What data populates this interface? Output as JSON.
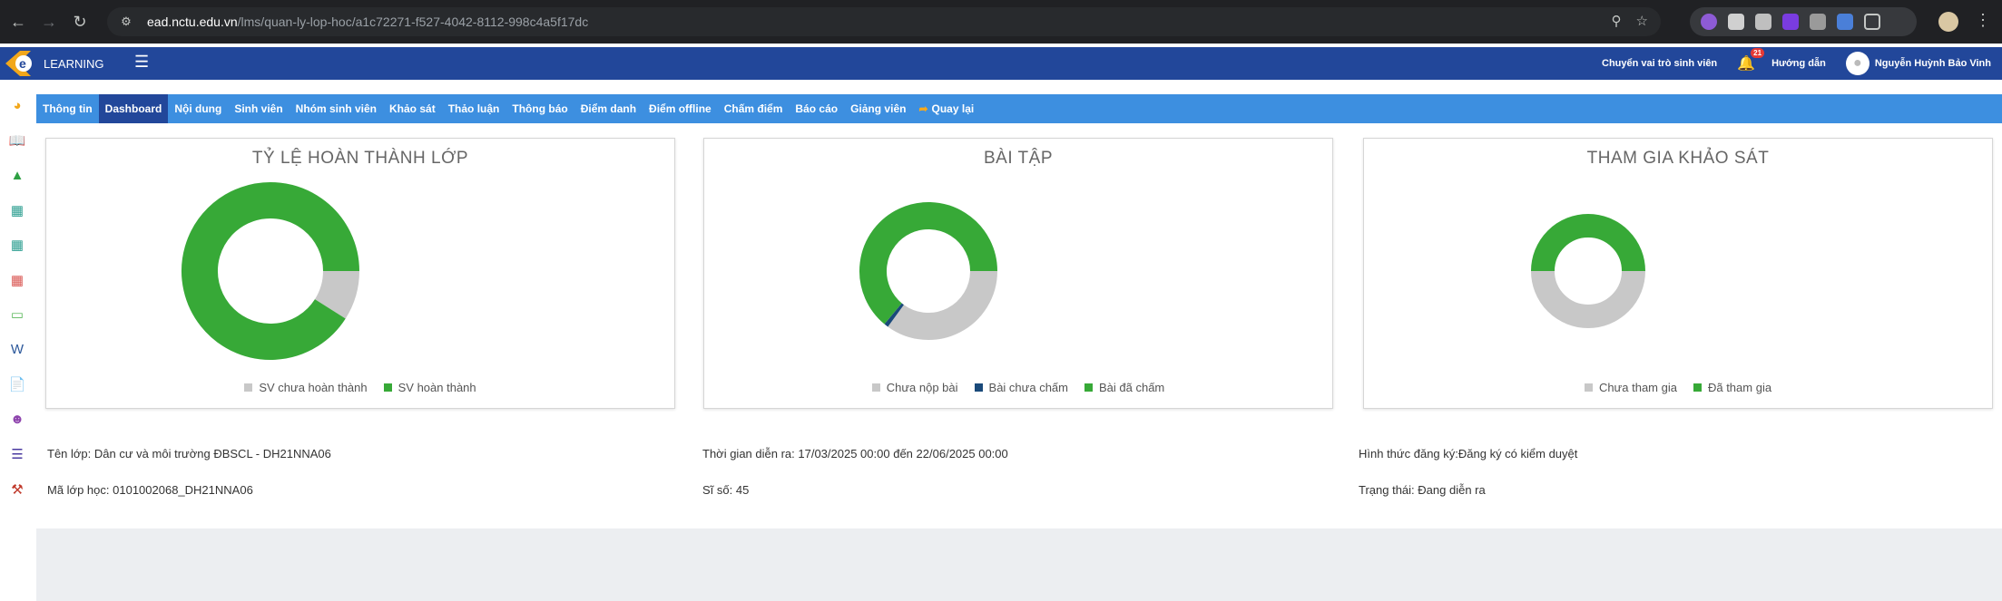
{
  "browser": {
    "url_host": "ead.nctu.edu.vn",
    "url_path": "/lms/quan-ly-lop-hoc/a1c72271-f527-4042-8112-998c4a5f17dc"
  },
  "header": {
    "logo_text": "LEARNING",
    "switch_role": "Chuyển vai trò sinh viên",
    "notification_count": "21",
    "guide": "Hướng dẫn",
    "user_name": "Nguyễn Huỳnh Bảo Vinh"
  },
  "tabs": [
    {
      "label": "Thông tin"
    },
    {
      "label": "Dashboard",
      "active": true
    },
    {
      "label": "Nội dung"
    },
    {
      "label": "Sinh viên"
    },
    {
      "label": "Nhóm sinh viên"
    },
    {
      "label": "Khảo sát"
    },
    {
      "label": "Thảo luận"
    },
    {
      "label": "Thông báo"
    },
    {
      "label": "Điểm danh"
    },
    {
      "label": "Điểm offline"
    },
    {
      "label": "Chấm điểm"
    },
    {
      "label": "Báo cáo"
    },
    {
      "label": "Giảng viên"
    },
    {
      "label": "Quay lại"
    }
  ],
  "sidebar_icons": [
    "dashboard-icon",
    "book-icon",
    "growth-chart-icon",
    "board-icon",
    "board-2-icon",
    "grid-icon",
    "calendar-icon",
    "word-icon",
    "document-icon",
    "teacher-icon",
    "list-icon",
    "tools-icon"
  ],
  "chart_data": [
    {
      "type": "pie",
      "title": "TỶ LỆ HOÀN THÀNH LỚP",
      "categories": [
        "SV chưa hoàn thành",
        "SV hoàn thành"
      ],
      "values": [
        9,
        91
      ],
      "colors": [
        "#c8c8c8",
        "#37a937"
      ],
      "donut": true,
      "half": false
    },
    {
      "type": "pie",
      "title": "BÀI TẬP",
      "categories": [
        "Chưa nộp bài",
        "Bài chưa chấm",
        "Bài đã chấm"
      ],
      "values": [
        35,
        1,
        64
      ],
      "colors": [
        "#c8c8c8",
        "#1a4a7a",
        "#37a937"
      ],
      "donut": true,
      "half": false
    },
    {
      "type": "pie",
      "title": "THAM GIA KHẢO SÁT",
      "categories": [
        "Chưa tham gia",
        "Đã tham gia"
      ],
      "values": [
        1,
        1
      ],
      "colors": [
        "#c8c8c8",
        "#37a937"
      ],
      "donut": true,
      "half": false
    }
  ],
  "class_info": {
    "name_label": "Tên lớp:",
    "name_value": "Dân cư và môi trường ĐBSCL - DH21NNA06",
    "code_label": "Mã lớp học:",
    "code_value": "0101002068_DH21NNA06",
    "time_label": "Thời gian diễn ra:",
    "time_start": "17/03/2025 00:00",
    "time_to": "đến",
    "time_end": "22/06/2025 00:00",
    "size_label": "Sĩ số:",
    "size_value": "45",
    "reg_label": "Hình thức đăng ký:",
    "reg_value": "Đăng ký có kiểm duyệt",
    "status_label": "Trạng thái:",
    "status_value": "Đang diễn ra"
  }
}
